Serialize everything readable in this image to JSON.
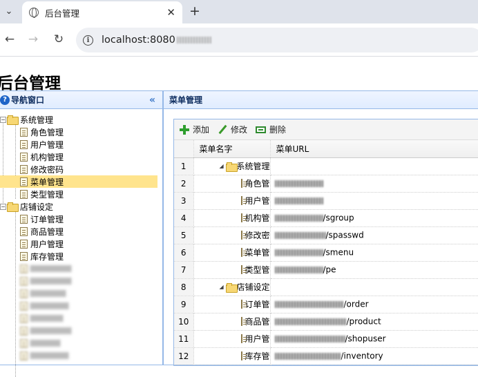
{
  "browser": {
    "tab_title": "后台管理",
    "close_glyph": "✕",
    "new_tab_glyph": "+",
    "menu_glyph": "⌄",
    "back_glyph": "←",
    "forward_glyph": "→",
    "reload_glyph": "↻",
    "url": "localhost:8080"
  },
  "app": {
    "title": "后台管理"
  },
  "west": {
    "header": "导航窗口",
    "collapse_glyph": "«",
    "groups": [
      {
        "label": "系统管理",
        "items": [
          "角色管理",
          "用户管理",
          "机构管理",
          "修改密码",
          "菜单管理",
          "类型管理"
        ]
      },
      {
        "label": "店铺设定",
        "items": [
          "订单管理",
          "商品管理",
          "用户管理",
          "库存管理"
        ]
      }
    ],
    "selected": "菜单管理"
  },
  "center": {
    "header": "菜单管理",
    "toolbar": {
      "add": "添加",
      "edit": "修改",
      "delete": "删除"
    },
    "columns": {
      "name": "菜单名字",
      "url": "菜单URL"
    },
    "rows": [
      {
        "n": "1",
        "name": "系统管理",
        "type": "folder",
        "url": ""
      },
      {
        "n": "2",
        "name": "角色管理",
        "type": "file",
        "url": ""
      },
      {
        "n": "3",
        "name": "用户管理",
        "type": "file",
        "url": ""
      },
      {
        "n": "4",
        "name": "机构管理",
        "type": "file",
        "url": "/sgroup"
      },
      {
        "n": "5",
        "name": "修改密码",
        "type": "file",
        "url": "/spasswd"
      },
      {
        "n": "6",
        "name": "菜单管理",
        "type": "file",
        "url": "/smenu"
      },
      {
        "n": "7",
        "name": "类型管理",
        "type": "file",
        "url": "/pe"
      },
      {
        "n": "8",
        "name": "店铺设定",
        "type": "folder",
        "url": ""
      },
      {
        "n": "9",
        "name": "订单管理",
        "type": "file",
        "url": "/order"
      },
      {
        "n": "10",
        "name": "商品管理",
        "type": "file",
        "url": "/product"
      },
      {
        "n": "11",
        "name": "用户管理",
        "type": "file",
        "url": "/shopuser"
      },
      {
        "n": "12",
        "name": "库存管理",
        "type": "file",
        "url": "/inventory"
      }
    ]
  }
}
